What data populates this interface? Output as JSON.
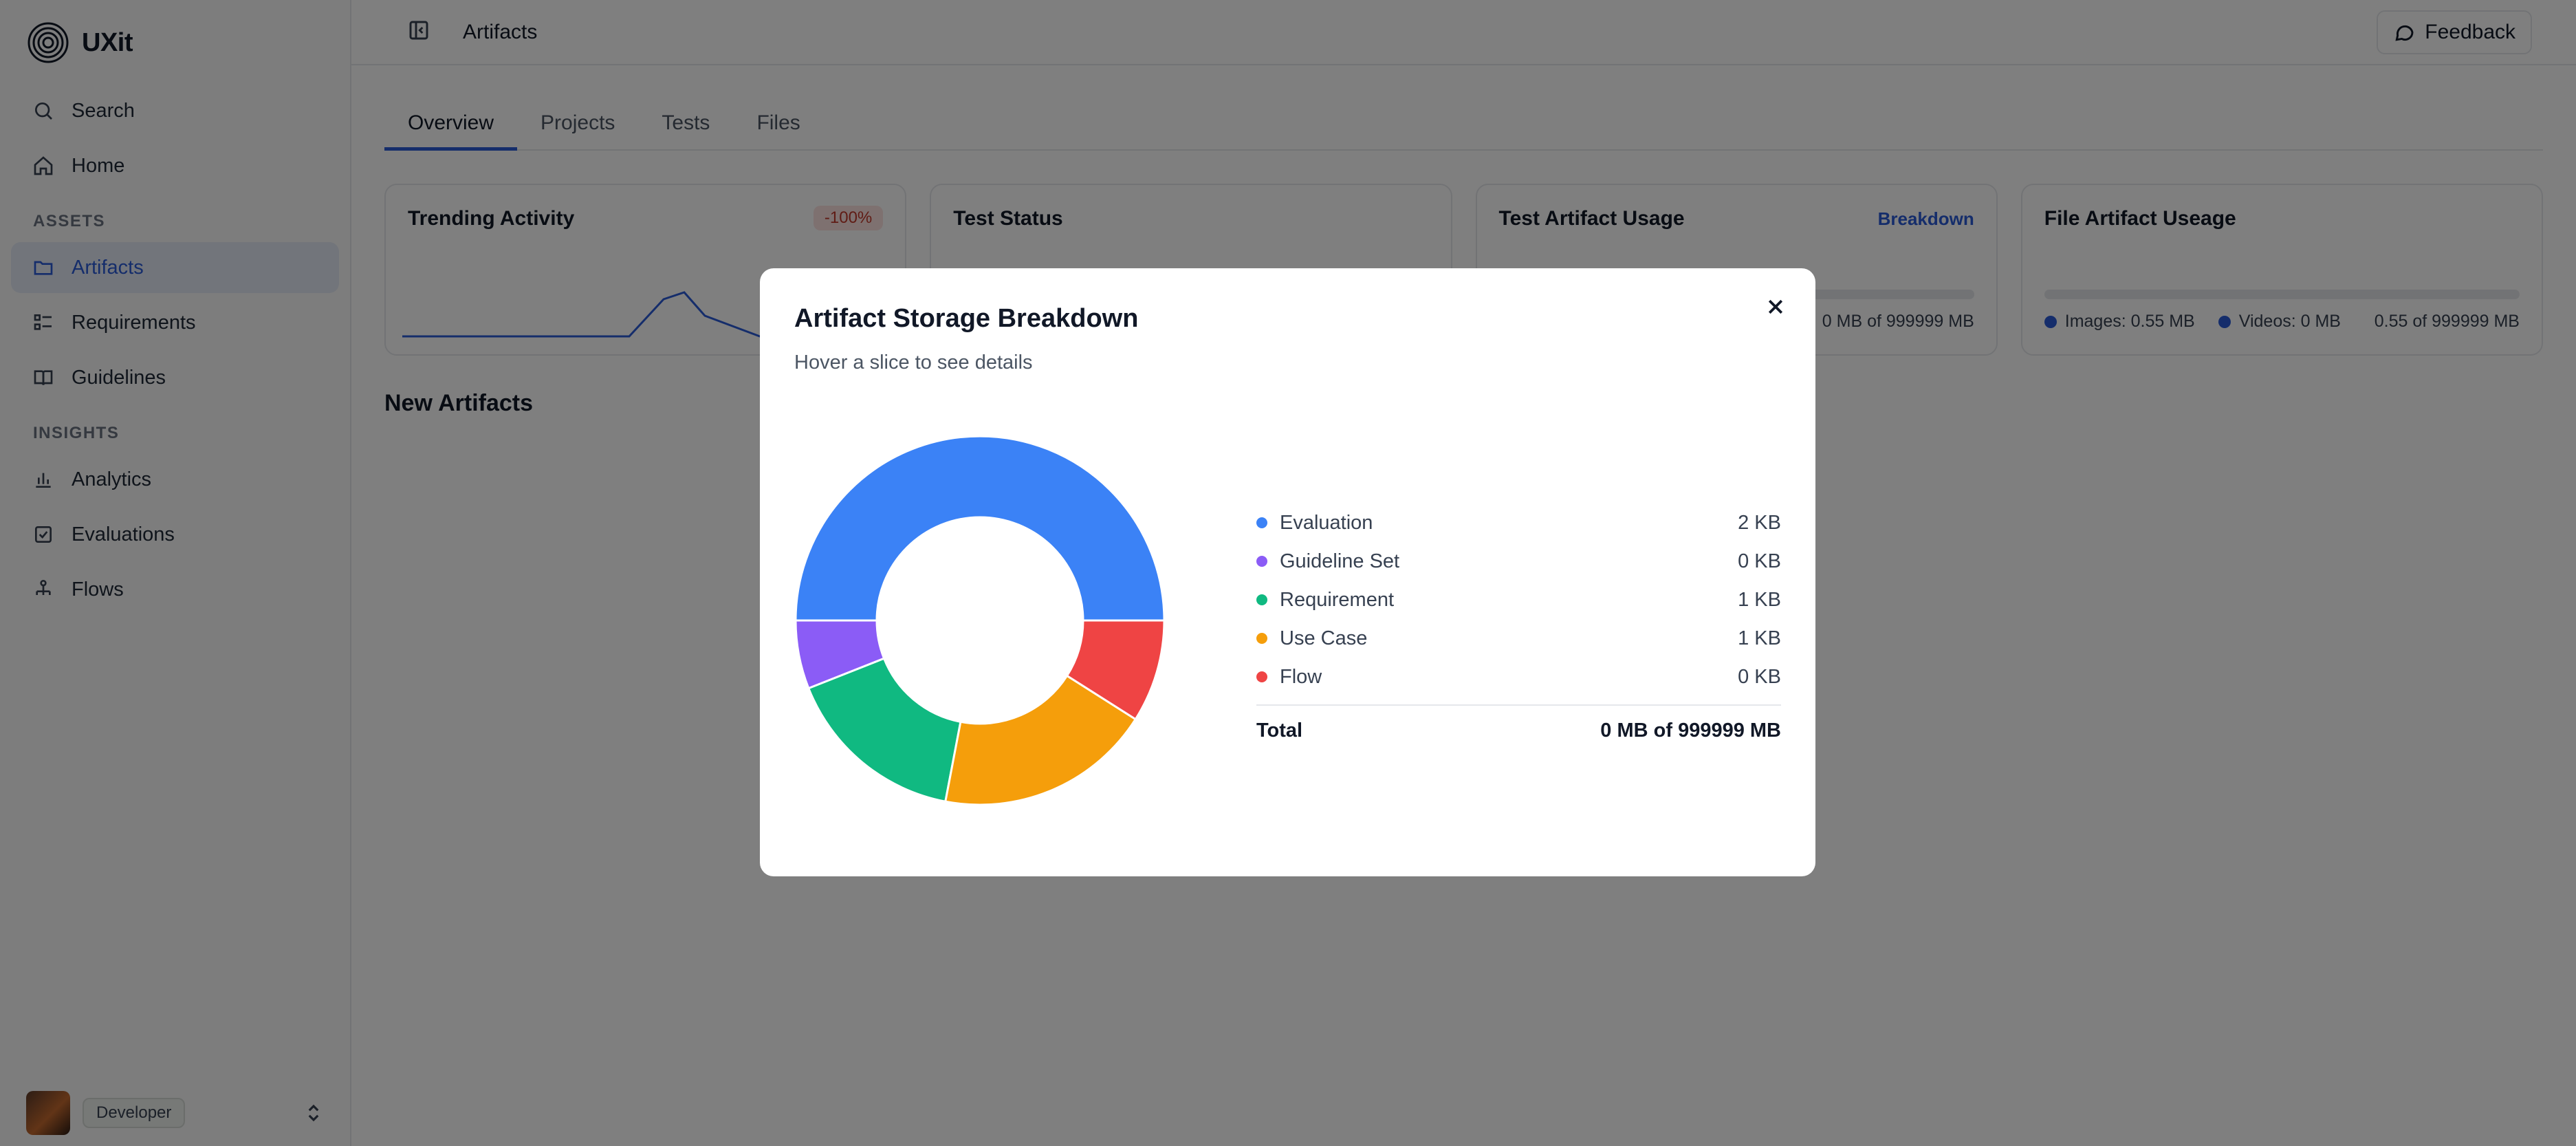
{
  "app": {
    "name": "UXit"
  },
  "sidebar": {
    "top_items": [
      {
        "label": "Search",
        "icon": "search-icon"
      },
      {
        "label": "Home",
        "icon": "home-icon"
      }
    ],
    "sections": [
      {
        "title": "ASSETS",
        "items": [
          {
            "label": "Artifacts",
            "icon": "folder-icon",
            "active": true
          },
          {
            "label": "Requirements",
            "icon": "list-icon"
          },
          {
            "label": "Guidelines",
            "icon": "book-icon"
          }
        ]
      },
      {
        "title": "INSIGHTS",
        "items": [
          {
            "label": "Analytics",
            "icon": "bar-chart-icon"
          },
          {
            "label": "Evaluations",
            "icon": "check-square-icon"
          },
          {
            "label": "Flows",
            "icon": "flow-icon"
          }
        ]
      }
    ],
    "footer": {
      "role": "Developer"
    }
  },
  "header": {
    "title": "Artifacts",
    "feedback_label": "Feedback"
  },
  "tabs": [
    "Overview",
    "Projects",
    "Tests",
    "Files"
  ],
  "cards": {
    "trending": {
      "title": "Trending Activity",
      "badge": "-100%"
    },
    "test_status": {
      "title": "Test Status"
    },
    "test_usage": {
      "title": "Test Artifact Usage",
      "link": "Breakdown",
      "summary": "0 MB of 999999 MB"
    },
    "file_usage": {
      "title": "File Artifact Useage",
      "images": "Images: 0.55 MB",
      "videos": "Videos: 0 MB",
      "summary": "0.55 of 999999 MB"
    }
  },
  "new_artifacts_title": "New Artifacts",
  "modal": {
    "title": "Artifact Storage Breakdown",
    "subtitle": "Hover a slice to see details",
    "total_label": "Total",
    "total_value": "0 MB of 999999 MB"
  },
  "chart_data": {
    "type": "pie",
    "donut": true,
    "categories": [
      "Evaluation",
      "Guideline Set",
      "Requirement",
      "Use Case",
      "Flow"
    ],
    "values": [
      2,
      0,
      1,
      1,
      0
    ],
    "value_labels": [
      "2 KB",
      "0 KB",
      "1 KB",
      "1 KB",
      "0 KB"
    ],
    "slice_shares": [
      0.5,
      0.06,
      0.16,
      0.19,
      0.09
    ],
    "colors": [
      "#3b82f6",
      "#8b5cf6",
      "#10b981",
      "#f59e0b",
      "#ef4444"
    ]
  }
}
